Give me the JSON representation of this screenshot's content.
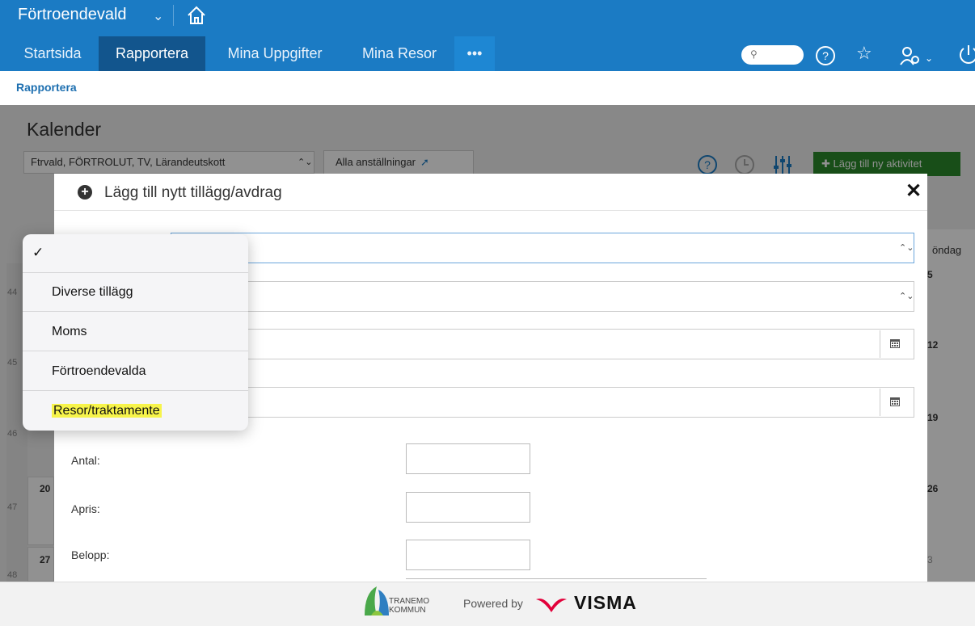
{
  "header": {
    "app_title": "Förtroendevald",
    "nav": [
      "Startsida",
      "Rapportera",
      "Mina Uppgifter",
      "Mina Resor",
      "•••"
    ],
    "active_nav": "Rapportera"
  },
  "breadcrumb": "Rapportera",
  "background_page": {
    "title": "Kalender",
    "filter_value": "Ftrvald, FÖRTROLUT, TV, Lärandeutskott",
    "employments_button": "Alla anställningar",
    "add_activity_button": "Lägg till ny aktivitet",
    "weeks": [
      "44",
      "45",
      "46",
      "47",
      "48"
    ],
    "left_dates": [
      "20",
      "27"
    ],
    "right_header": "öndag",
    "right_dates": [
      "5",
      "12",
      "19",
      "26",
      "3"
    ]
  },
  "modal": {
    "title": "Lägg till nytt tillägg/avdrag",
    "labels": {
      "antal": "Antal:",
      "apris": "Apris:",
      "belopp": "Belopp:"
    }
  },
  "picker": {
    "selected_mark": "✓",
    "options": [
      "Diverse tillägg",
      "Moms",
      "Förtroendevalda",
      "Resor/traktamente"
    ],
    "highlighted": "Resor/traktamente"
  },
  "footer": {
    "tranemo_line1": "TRANEMO",
    "tranemo_line2": "KOMMUN",
    "powered_by": "Powered by",
    "visma": "VISMA"
  },
  "colors": {
    "header_blue": "#1b7bc4",
    "active_tab": "#12558d",
    "add_button_green": "#2b8a2b",
    "highlight_yellow": "#f7f44a",
    "visma_red": "#e2003a"
  }
}
